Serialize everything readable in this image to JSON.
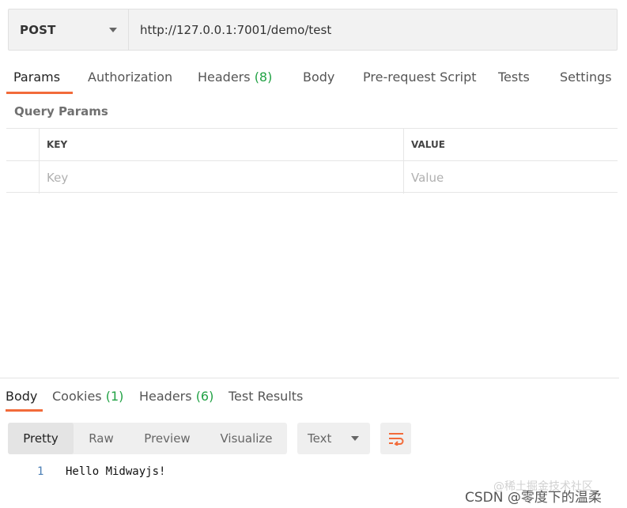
{
  "request": {
    "method": "POST",
    "url": "http://127.0.0.1:7001/demo/test"
  },
  "request_tabs": [
    {
      "label": "Params",
      "count": ""
    },
    {
      "label": "Authorization",
      "count": ""
    },
    {
      "label": "Headers",
      "count": "(8)"
    },
    {
      "label": "Body",
      "count": ""
    },
    {
      "label": "Pre-request Script",
      "count": ""
    },
    {
      "label": "Tests",
      "count": ""
    },
    {
      "label": "Settings",
      "count": ""
    }
  ],
  "active_request_tab": "Params",
  "query_params": {
    "title": "Query Params",
    "columns": [
      "KEY",
      "VALUE"
    ],
    "key_placeholder": "Key",
    "value_placeholder": "Value"
  },
  "response_tabs": [
    {
      "label": "Body",
      "count": ""
    },
    {
      "label": "Cookies",
      "count": "(1)"
    },
    {
      "label": "Headers",
      "count": "(6)"
    },
    {
      "label": "Test Results",
      "count": ""
    }
  ],
  "active_response_tab": "Body",
  "view_modes": [
    "Pretty",
    "Raw",
    "Preview",
    "Visualize"
  ],
  "active_view_mode": "Pretty",
  "format": "Text",
  "response_body": [
    {
      "line": "1",
      "text": "Hello Midwayjs!"
    }
  ],
  "watermarks": [
    "@稀土掘金技术社区",
    "CSDN @零度下的温柔"
  ],
  "colors": {
    "accent": "#f26b3a",
    "count_green": "#22a245",
    "line_number": "#4a7eb5"
  },
  "icons": {
    "method_dropdown": "chevron-down-icon",
    "format_dropdown": "chevron-down-icon",
    "wrap": "wrap-lines-icon"
  }
}
